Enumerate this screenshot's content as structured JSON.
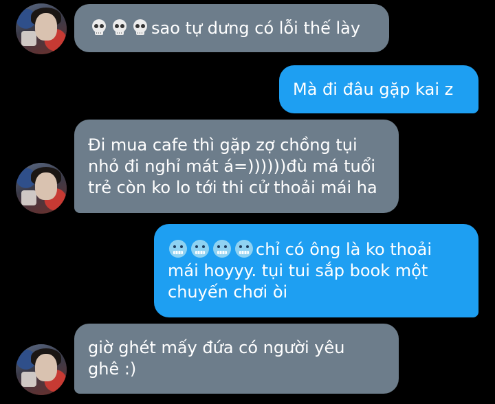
{
  "messages": [
    {
      "from": "them",
      "emoji_count": 3,
      "emoji": "skull-icon",
      "text": "sao tự dưng có lỗi thế lày"
    },
    {
      "from": "me",
      "text": "Mà đi đâu gặp kai z"
    },
    {
      "from": "them",
      "lines": [
        "Đi mua cafe thì gặp zợ chồng tụi",
        "nhỏ đi nghỉ mát á=))))))đù má tuổi",
        "trẻ còn ko lo tới thi cử thoải mái ha"
      ]
    },
    {
      "from": "me",
      "emoji_count": 4,
      "emoji": "cold-face-icon",
      "lines": [
        "chỉ có ông là ko thoải",
        "mái hoyyy. tụi tui sắp book một",
        "chuyến chơi òi"
      ]
    },
    {
      "from": "them",
      "lines": [
        "giờ ghét mấy đứa có người yêu",
        "ghê :)"
      ]
    }
  ],
  "colors": {
    "incoming": "#6d7d8b",
    "outgoing": "#1e9ff2",
    "background": "#000000"
  }
}
